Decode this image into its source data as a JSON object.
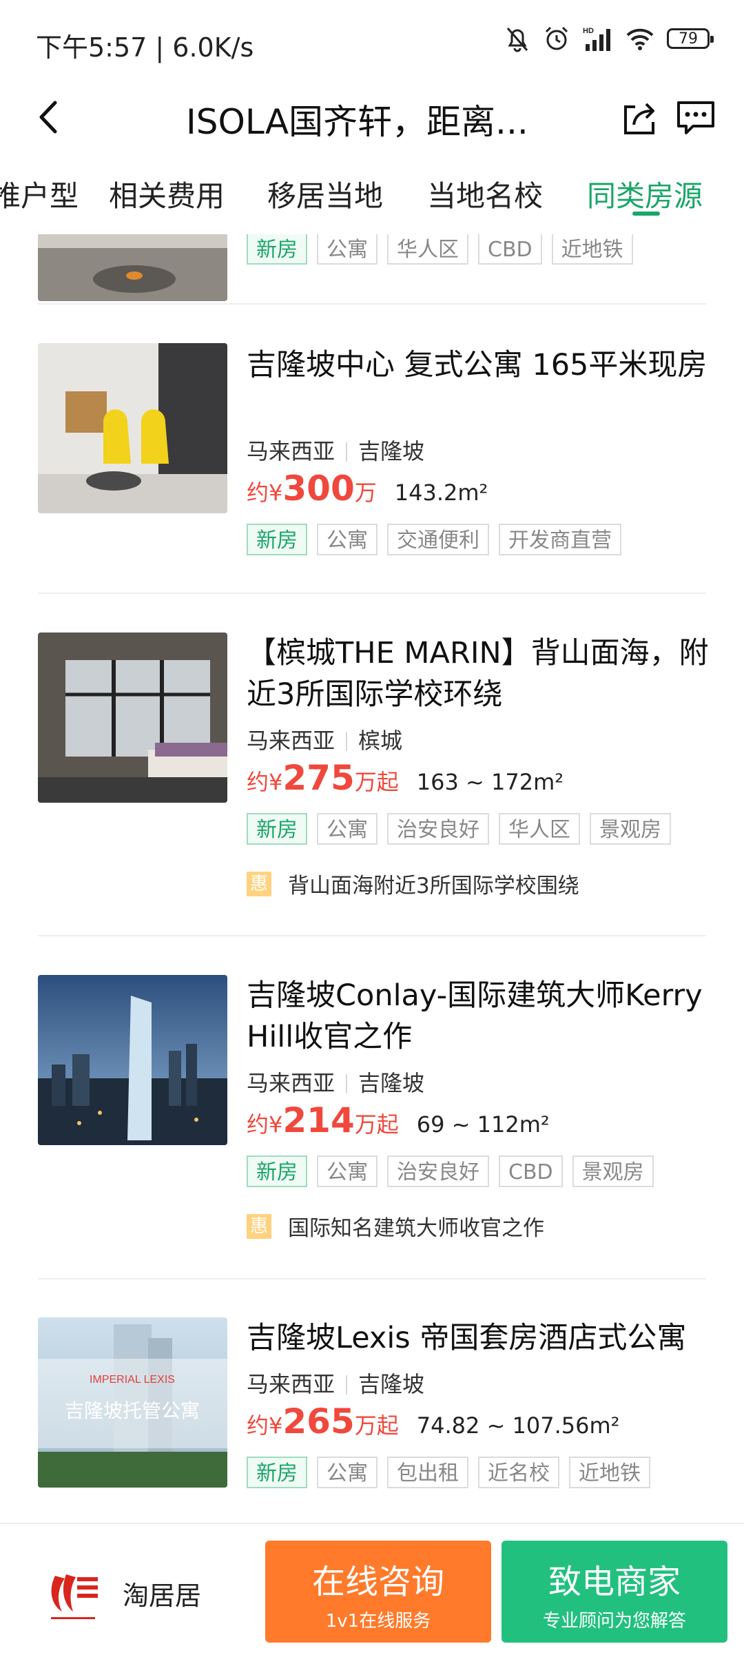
{
  "status_bar": {
    "time": "下午5:57 | 6.0K/s",
    "battery": "79",
    "hd_label": "HD"
  },
  "header": {
    "title": "ISOLA国齐轩，距离..."
  },
  "tabs": [
    {
      "label": "推户型"
    },
    {
      "label": "相关费用"
    },
    {
      "label": "移居当地"
    },
    {
      "label": "当地名校"
    },
    {
      "label": "同类房源",
      "active": true
    }
  ],
  "top_partial_item": {
    "tags": [
      "新房",
      "公寓",
      "华人区",
      "CBD",
      "近地铁"
    ]
  },
  "listings": [
    {
      "title": "吉隆坡中心 复式公寓 165平米现房",
      "country": "马来西亚",
      "city": "吉隆坡",
      "price_prefix": "约¥",
      "price": "300",
      "price_suffix": "万",
      "area": "143.2m²",
      "tags": [
        "新房",
        "公寓",
        "交通便利",
        "开发商直营"
      ],
      "promo": null
    },
    {
      "title": "【槟城THE MARIN】背山面海，附近3所国际学校环绕",
      "country": "马来西亚",
      "city": "槟城",
      "price_prefix": "约¥",
      "price": "275",
      "price_suffix": "万起",
      "area": "163 ~ 172m²",
      "tags": [
        "新房",
        "公寓",
        "治安良好",
        "华人区",
        "景观房"
      ],
      "promo_badge": "惠",
      "promo": "背山面海附近3所国际学校围绕"
    },
    {
      "title": "吉隆坡Conlay-国际建筑大师Kerry Hill收官之作",
      "country": "马来西亚",
      "city": "吉隆坡",
      "price_prefix": "约¥",
      "price": "214",
      "price_suffix": "万起",
      "area": "69 ~ 112m²",
      "tags": [
        "新房",
        "公寓",
        "治安良好",
        "CBD",
        "景观房"
      ],
      "promo_badge": "惠",
      "promo": "国际知名建筑大师收官之作"
    },
    {
      "title": "吉隆坡Lexis 帝国套房酒店式公寓",
      "country": "马来西亚",
      "city": "吉隆坡",
      "price_prefix": "约¥",
      "price": "265",
      "price_suffix": "万起",
      "area": "74.82 ~ 107.56m²",
      "tags": [
        "新房",
        "公寓",
        "包出租",
        "近名校",
        "近地铁"
      ],
      "image_caption": "吉隆坡托管公寓",
      "image_brand": "IMPERIAL LEXIS",
      "promo": null
    }
  ],
  "bottom_bar": {
    "brand_name": "淘居居",
    "consult_button": "在线咨询",
    "consult_sub": "1v1在线服务",
    "call_button": "致电商家",
    "call_sub": "专业顾问为您解答"
  },
  "colors": {
    "accent_green": "#1aa668",
    "price_red": "#f0483c",
    "button_orange": "#ff7a2b",
    "button_green": "#22c07f"
  }
}
